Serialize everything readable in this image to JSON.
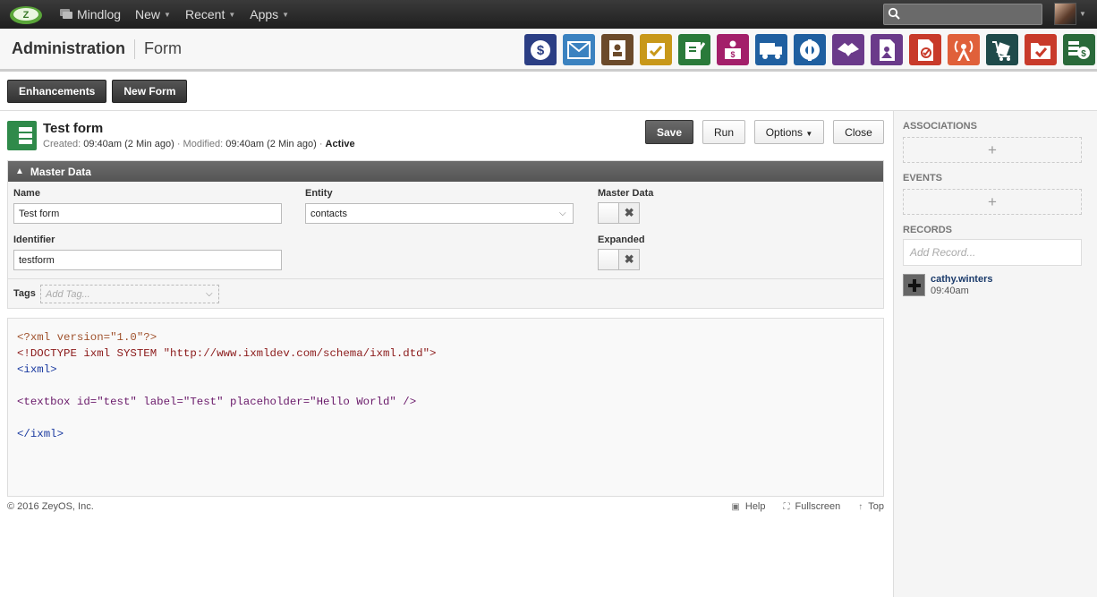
{
  "topbar": {
    "nav": [
      {
        "label": "Mindlog",
        "icon": "chat-icon"
      },
      {
        "label": "New",
        "has_menu": true
      },
      {
        "label": "Recent",
        "has_menu": true
      },
      {
        "label": "Apps",
        "has_menu": true
      }
    ],
    "search_placeholder": ""
  },
  "header": {
    "title": "Administration",
    "subtitle": "Form",
    "app_icons": [
      {
        "name": "billing-icon",
        "color": "#2b3e84"
      },
      {
        "name": "mail-icon",
        "color": "#3b82c0"
      },
      {
        "name": "contacts-icon",
        "color": "#6b4a2a"
      },
      {
        "name": "tasks-icon",
        "color": "#c8981a"
      },
      {
        "name": "notes-icon",
        "color": "#2a7a3a"
      },
      {
        "name": "sales-icon",
        "color": "#a31f6a"
      },
      {
        "name": "shipping-icon",
        "color": "#1f5fa0"
      },
      {
        "name": "support-icon",
        "color": "#1f5fa0"
      },
      {
        "name": "partners-icon",
        "color": "#6a3a8a"
      },
      {
        "name": "documents-icon",
        "color": "#6a3a8a"
      },
      {
        "name": "contracts-icon",
        "color": "#c83a2a"
      },
      {
        "name": "campaigns-icon",
        "color": "#e0603a"
      },
      {
        "name": "stock-icon",
        "color": "#1f4a4a"
      },
      {
        "name": "projects-icon",
        "color": "#c83a2a"
      },
      {
        "name": "finance-icon",
        "color": "#2a6a3a"
      }
    ]
  },
  "toolbar": {
    "enhancements_label": "Enhancements",
    "new_form_label": "New Form"
  },
  "form": {
    "title": "Test form",
    "created_label": "Created:",
    "created_value": "09:40am (2 Min ago)",
    "modified_label": "· Modified:",
    "modified_value": "09:40am (2 Min ago)",
    "status": "Active",
    "save_label": "Save",
    "run_label": "Run",
    "options_label": "Options",
    "close_label": "Close"
  },
  "master_data": {
    "section_title": "Master Data",
    "name_label": "Name",
    "name_value": "Test form",
    "entity_label": "Entity",
    "entity_value": "contacts",
    "master_data_label": "Master Data",
    "identifier_label": "Identifier",
    "identifier_value": "testform",
    "expanded_label": "Expanded",
    "tags_label": "Tags",
    "tags_placeholder": "Add Tag..."
  },
  "code_lines": [
    "<?xml version=\"1.0\"?>",
    "<!DOCTYPE ixml SYSTEM \"http://www.ixmldev.com/schema/ixml.dtd\">",
    "<ixml>",
    "",
    "<textbox id=\"test\" label=\"Test\" placeholder=\"Hello World\" />",
    "",
    "</ixml>"
  ],
  "footer": {
    "copyright": "© 2016 ZeyOS, Inc.",
    "help_label": "Help",
    "fullscreen_label": "Fullscreen",
    "top_label": "Top"
  },
  "sidebar": {
    "associations_label": "ASSOCIATIONS",
    "events_label": "EVENTS",
    "records_label": "RECORDS",
    "add_record_placeholder": "Add Record...",
    "record_user": "cathy.winters",
    "record_time": "09:40am"
  }
}
